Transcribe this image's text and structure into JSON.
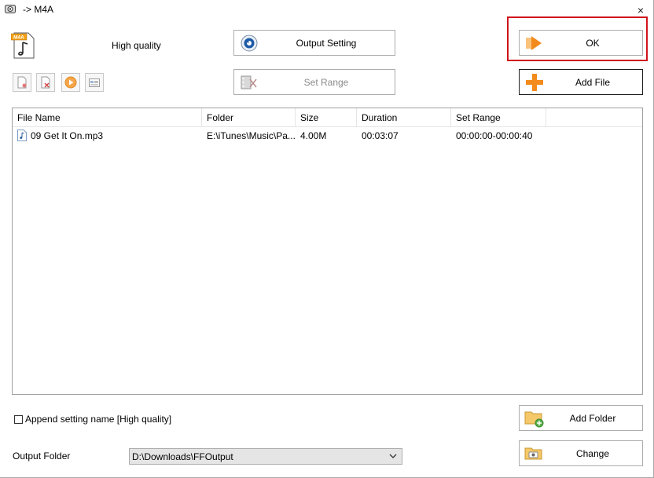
{
  "window": {
    "title": "-> M4A",
    "close_glyph": "×"
  },
  "format": {
    "icon_label": "M4A",
    "quality": "High quality"
  },
  "buttons": {
    "output_setting": "Output Setting",
    "set_range": "Set Range",
    "ok": "OK",
    "add_file": "Add File",
    "add_folder": "Add Folder",
    "change": "Change"
  },
  "table": {
    "columns": [
      "File Name",
      "Folder",
      "Size",
      "Duration",
      "Set Range"
    ],
    "rows": [
      {
        "file_name": "09 Get It On.mp3",
        "folder": "E:\\iTunes\\Music\\Pa...",
        "size": "4.00M",
        "duration": "00:03:07",
        "set_range": "00:00:00-00:00:40"
      }
    ]
  },
  "append_setting": {
    "label": "Append setting name [High quality]",
    "checked": false
  },
  "output_folder": {
    "label": "Output Folder",
    "value": "D:\\Downloads\\FFOutput"
  },
  "colors": {
    "highlight": "#d0141c",
    "accent_orange": "#f28a1c"
  },
  "icons": {
    "toolbar": [
      "remove-file-icon",
      "clear-list-icon",
      "play-icon",
      "file-info-icon"
    ]
  }
}
